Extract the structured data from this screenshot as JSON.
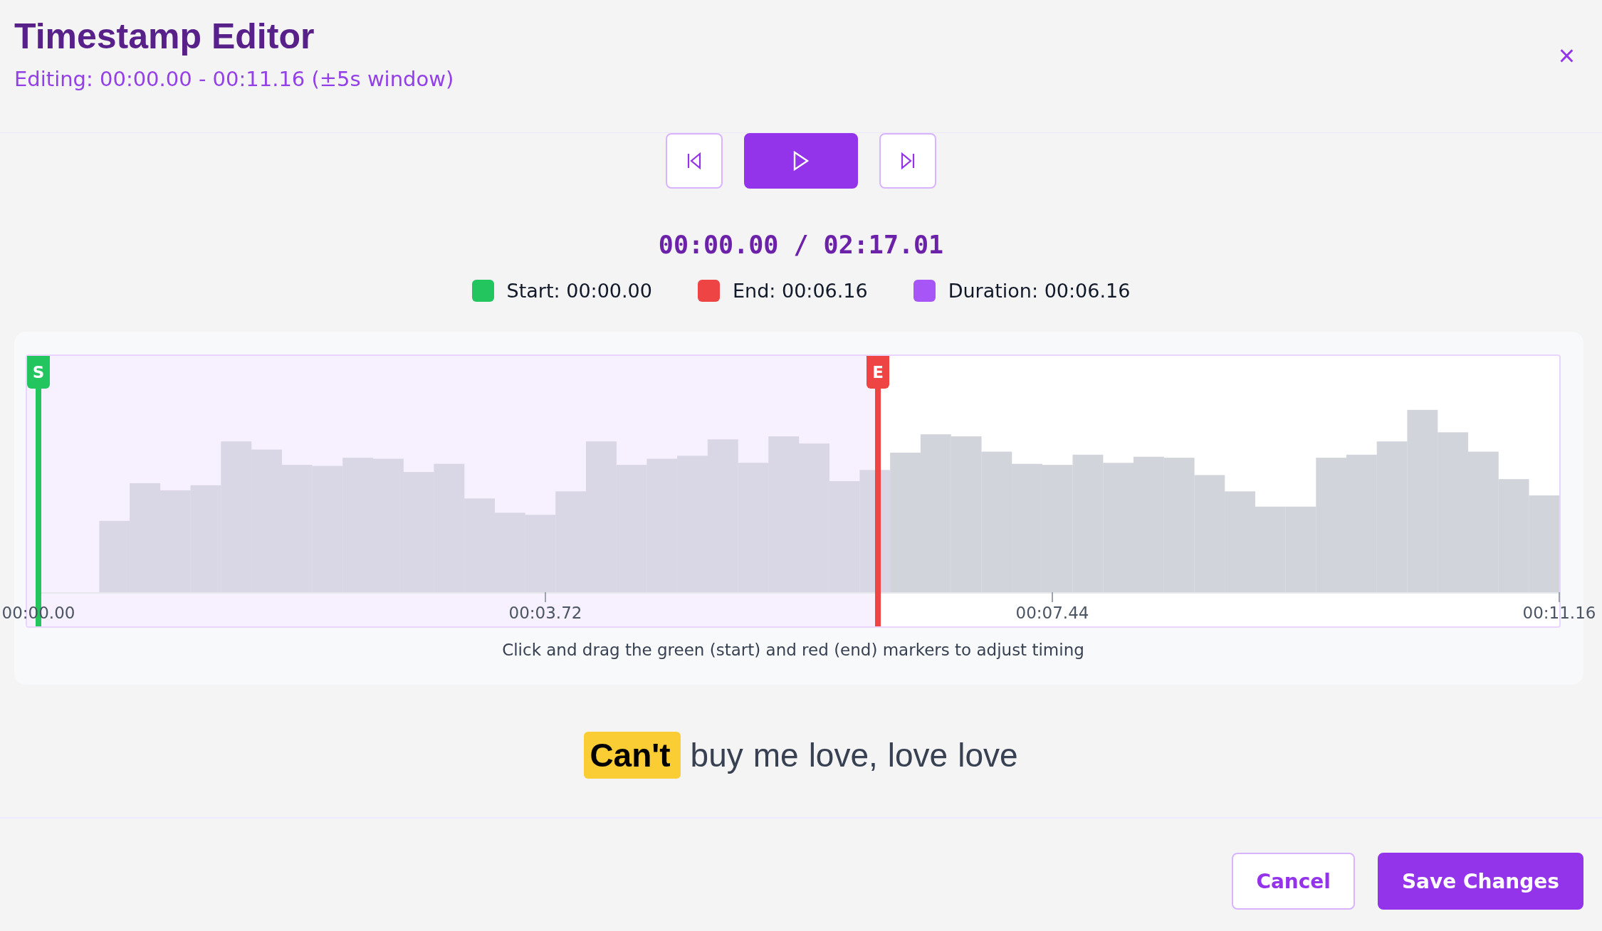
{
  "header": {
    "title": "Timestamp Editor",
    "subtitle": "Editing: 00:00.00 - 00:11.16 (±5s window)",
    "close": "×"
  },
  "transport": [
    {
      "kind": "previous"
    },
    {
      "kind": "play"
    },
    {
      "kind": "next"
    }
  ],
  "time_display": "00:00.00 / 02:17.01",
  "legend": [
    {
      "label": "Start: 00:00.00",
      "color": "#22c55e"
    },
    {
      "label": "End: 00:06.16",
      "color": "#ef4444"
    },
    {
      "label": "Duration: 00:06.16",
      "color": "#a855f7"
    }
  ],
  "waveform": {
    "start_marker": {
      "label": "S",
      "level": 0
    },
    "end_marker": {
      "label": "E",
      "level": 0.552
    },
    "axis_labels": [
      "00:00.00",
      "00:03.72",
      "00:07.44",
      "00:11.16"
    ],
    "hint": "Click and drag the green (start) and red (end) markers to adjust timing"
  },
  "lyric": [
    {
      "text": "Can't",
      "highlighted": true
    },
    {
      "text": "buy",
      "highlighted": false
    },
    {
      "text": "me",
      "highlighted": false
    },
    {
      "text": "love,",
      "highlighted": false
    },
    {
      "text": "love",
      "highlighted": false
    },
    {
      "text": "love",
      "highlighted": false
    }
  ],
  "buttons": [
    {
      "label": "Cancel",
      "kind": "secondary"
    },
    {
      "label": "Save Changes",
      "kind": "primary"
    }
  ]
}
